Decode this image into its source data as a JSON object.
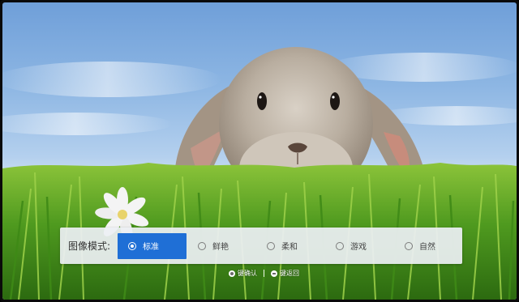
{
  "picture_mode": {
    "title": "图像模式:",
    "options": [
      {
        "label": "标准",
        "selected": true
      },
      {
        "label": "鲜艳",
        "selected": false
      },
      {
        "label": "柔和",
        "selected": false
      },
      {
        "label": "游戏",
        "selected": false
      },
      {
        "label": "自然",
        "selected": false
      }
    ]
  },
  "hints": {
    "confirm": "键确认",
    "back": "键返回"
  },
  "colors": {
    "selected_bg": "#1f6fd6",
    "bar_bg": "#eceff3"
  },
  "icons": {
    "radio_selected": "radio-selected-icon",
    "radio_unselected": "radio-unselected-icon",
    "ok_key": "ok-key-icon",
    "back_key": "back-key-icon"
  }
}
